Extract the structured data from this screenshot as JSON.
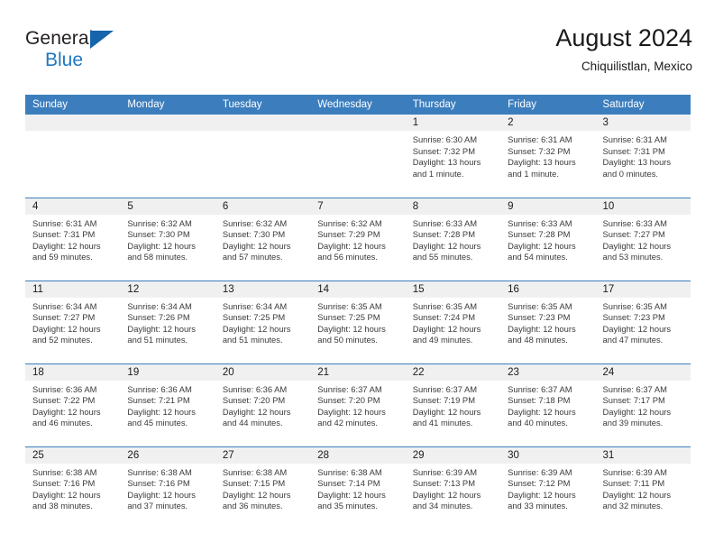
{
  "brand": {
    "name_top": "General",
    "name_bottom": "Blue",
    "triangle_color": "#1664ab",
    "blue_color": "#1f78c1"
  },
  "header": {
    "title": "August 2024",
    "subtitle": "Chiquilistlan, Mexico"
  },
  "theme": {
    "header_row_bg": "#3c7ebd",
    "daynum_bg": "#f0f0f0",
    "row_divider": "#3c7ebd"
  },
  "weekdays": [
    "Sunday",
    "Monday",
    "Tuesday",
    "Wednesday",
    "Thursday",
    "Friday",
    "Saturday"
  ],
  "labels": {
    "sunrise_prefix": "Sunrise:",
    "sunset_prefix": "Sunset:",
    "daylight_prefix": "Daylight:"
  },
  "weeks": [
    [
      {
        "day": "",
        "empty": true
      },
      {
        "day": "",
        "empty": true
      },
      {
        "day": "",
        "empty": true
      },
      {
        "day": "",
        "empty": true
      },
      {
        "day": "1",
        "sunrise": "Sunrise: 6:30 AM",
        "sunset": "Sunset: 7:32 PM",
        "daylight": "Daylight: 13 hours and 1 minute."
      },
      {
        "day": "2",
        "sunrise": "Sunrise: 6:31 AM",
        "sunset": "Sunset: 7:32 PM",
        "daylight": "Daylight: 13 hours and 1 minute."
      },
      {
        "day": "3",
        "sunrise": "Sunrise: 6:31 AM",
        "sunset": "Sunset: 7:31 PM",
        "daylight": "Daylight: 13 hours and 0 minutes."
      }
    ],
    [
      {
        "day": "4",
        "sunrise": "Sunrise: 6:31 AM",
        "sunset": "Sunset: 7:31 PM",
        "daylight": "Daylight: 12 hours and 59 minutes."
      },
      {
        "day": "5",
        "sunrise": "Sunrise: 6:32 AM",
        "sunset": "Sunset: 7:30 PM",
        "daylight": "Daylight: 12 hours and 58 minutes."
      },
      {
        "day": "6",
        "sunrise": "Sunrise: 6:32 AM",
        "sunset": "Sunset: 7:30 PM",
        "daylight": "Daylight: 12 hours and 57 minutes."
      },
      {
        "day": "7",
        "sunrise": "Sunrise: 6:32 AM",
        "sunset": "Sunset: 7:29 PM",
        "daylight": "Daylight: 12 hours and 56 minutes."
      },
      {
        "day": "8",
        "sunrise": "Sunrise: 6:33 AM",
        "sunset": "Sunset: 7:28 PM",
        "daylight": "Daylight: 12 hours and 55 minutes."
      },
      {
        "day": "9",
        "sunrise": "Sunrise: 6:33 AM",
        "sunset": "Sunset: 7:28 PM",
        "daylight": "Daylight: 12 hours and 54 minutes."
      },
      {
        "day": "10",
        "sunrise": "Sunrise: 6:33 AM",
        "sunset": "Sunset: 7:27 PM",
        "daylight": "Daylight: 12 hours and 53 minutes."
      }
    ],
    [
      {
        "day": "11",
        "sunrise": "Sunrise: 6:34 AM",
        "sunset": "Sunset: 7:27 PM",
        "daylight": "Daylight: 12 hours and 52 minutes."
      },
      {
        "day": "12",
        "sunrise": "Sunrise: 6:34 AM",
        "sunset": "Sunset: 7:26 PM",
        "daylight": "Daylight: 12 hours and 51 minutes."
      },
      {
        "day": "13",
        "sunrise": "Sunrise: 6:34 AM",
        "sunset": "Sunset: 7:25 PM",
        "daylight": "Daylight: 12 hours and 51 minutes."
      },
      {
        "day": "14",
        "sunrise": "Sunrise: 6:35 AM",
        "sunset": "Sunset: 7:25 PM",
        "daylight": "Daylight: 12 hours and 50 minutes."
      },
      {
        "day": "15",
        "sunrise": "Sunrise: 6:35 AM",
        "sunset": "Sunset: 7:24 PM",
        "daylight": "Daylight: 12 hours and 49 minutes."
      },
      {
        "day": "16",
        "sunrise": "Sunrise: 6:35 AM",
        "sunset": "Sunset: 7:23 PM",
        "daylight": "Daylight: 12 hours and 48 minutes."
      },
      {
        "day": "17",
        "sunrise": "Sunrise: 6:35 AM",
        "sunset": "Sunset: 7:23 PM",
        "daylight": "Daylight: 12 hours and 47 minutes."
      }
    ],
    [
      {
        "day": "18",
        "sunrise": "Sunrise: 6:36 AM",
        "sunset": "Sunset: 7:22 PM",
        "daylight": "Daylight: 12 hours and 46 minutes."
      },
      {
        "day": "19",
        "sunrise": "Sunrise: 6:36 AM",
        "sunset": "Sunset: 7:21 PM",
        "daylight": "Daylight: 12 hours and 45 minutes."
      },
      {
        "day": "20",
        "sunrise": "Sunrise: 6:36 AM",
        "sunset": "Sunset: 7:20 PM",
        "daylight": "Daylight: 12 hours and 44 minutes."
      },
      {
        "day": "21",
        "sunrise": "Sunrise: 6:37 AM",
        "sunset": "Sunset: 7:20 PM",
        "daylight": "Daylight: 12 hours and 42 minutes."
      },
      {
        "day": "22",
        "sunrise": "Sunrise: 6:37 AM",
        "sunset": "Sunset: 7:19 PM",
        "daylight": "Daylight: 12 hours and 41 minutes."
      },
      {
        "day": "23",
        "sunrise": "Sunrise: 6:37 AM",
        "sunset": "Sunset: 7:18 PM",
        "daylight": "Daylight: 12 hours and 40 minutes."
      },
      {
        "day": "24",
        "sunrise": "Sunrise: 6:37 AM",
        "sunset": "Sunset: 7:17 PM",
        "daylight": "Daylight: 12 hours and 39 minutes."
      }
    ],
    [
      {
        "day": "25",
        "sunrise": "Sunrise: 6:38 AM",
        "sunset": "Sunset: 7:16 PM",
        "daylight": "Daylight: 12 hours and 38 minutes."
      },
      {
        "day": "26",
        "sunrise": "Sunrise: 6:38 AM",
        "sunset": "Sunset: 7:16 PM",
        "daylight": "Daylight: 12 hours and 37 minutes."
      },
      {
        "day": "27",
        "sunrise": "Sunrise: 6:38 AM",
        "sunset": "Sunset: 7:15 PM",
        "daylight": "Daylight: 12 hours and 36 minutes."
      },
      {
        "day": "28",
        "sunrise": "Sunrise: 6:38 AM",
        "sunset": "Sunset: 7:14 PM",
        "daylight": "Daylight: 12 hours and 35 minutes."
      },
      {
        "day": "29",
        "sunrise": "Sunrise: 6:39 AM",
        "sunset": "Sunset: 7:13 PM",
        "daylight": "Daylight: 12 hours and 34 minutes."
      },
      {
        "day": "30",
        "sunrise": "Sunrise: 6:39 AM",
        "sunset": "Sunset: 7:12 PM",
        "daylight": "Daylight: 12 hours and 33 minutes."
      },
      {
        "day": "31",
        "sunrise": "Sunrise: 6:39 AM",
        "sunset": "Sunset: 7:11 PM",
        "daylight": "Daylight: 12 hours and 32 minutes."
      }
    ]
  ]
}
